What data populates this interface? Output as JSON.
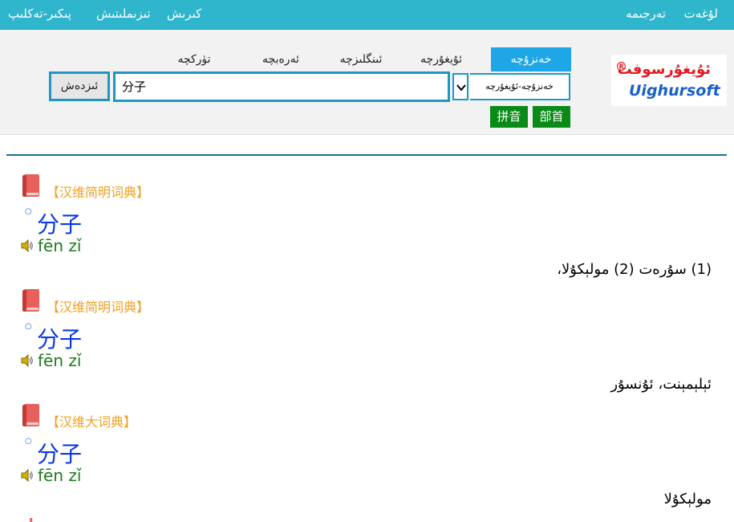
{
  "topbar": {
    "lughet": "لۇغەت",
    "terjime": "تەرجىمە",
    "kirish": "كىرىش",
    "tizimlitish": "تىزىملىتىش",
    "pikir": "پىكىر-تەكلىپ"
  },
  "tabs": [
    {
      "label": "خەنزۇچە",
      "active": true
    },
    {
      "label": "ئۇيغۇرچە",
      "active": false
    },
    {
      "label": "ئىنگلىزچە",
      "active": false
    },
    {
      "label": "ئەرەبچە",
      "active": false
    },
    {
      "label": "تۈركچە",
      "active": false
    }
  ],
  "search": {
    "button_label": "ئىزدەش",
    "value": "分子",
    "select_value": "خەنزۇچە-ئۇيغۇرچە"
  },
  "buttons": {
    "pinyin": "拼音",
    "bushou": "部首"
  },
  "logo": {
    "uyghur": "ئۇيغۇرسوفت",
    "registered": "®",
    "english": "Uighursoft"
  },
  "entries": [
    {
      "source": "【汉维简明词典】",
      "word": "分子",
      "pinyin": "fēn zǐ",
      "meaning": "(1) سۇرەت (2) مولېكۇلا،"
    },
    {
      "source": "【汉维简明词典】",
      "word": "分子",
      "pinyin": "fēn zǐ",
      "meaning": "ئېلېمېنت، ئۇنسۇر"
    },
    {
      "source": "【汉维大词典】",
      "word": "分子",
      "pinyin": "fēn zǐ",
      "meaning": "مولېكۇلا"
    }
  ],
  "colors": {
    "topbar": "#2fb5cc",
    "active_tab": "#1fa6e6",
    "input_border": "#1f97c4",
    "green_button": "#0a8a16",
    "source_text": "#f0a020",
    "word_text": "#0a39e0",
    "pinyin_text": "#1e7a1e",
    "logo_red": "#e41b23",
    "logo_blue": "#1a5fc8"
  },
  "icons": {
    "book": "book-icon",
    "speaker": "speaker-icon",
    "dropdown": "chevron-down-icon"
  }
}
